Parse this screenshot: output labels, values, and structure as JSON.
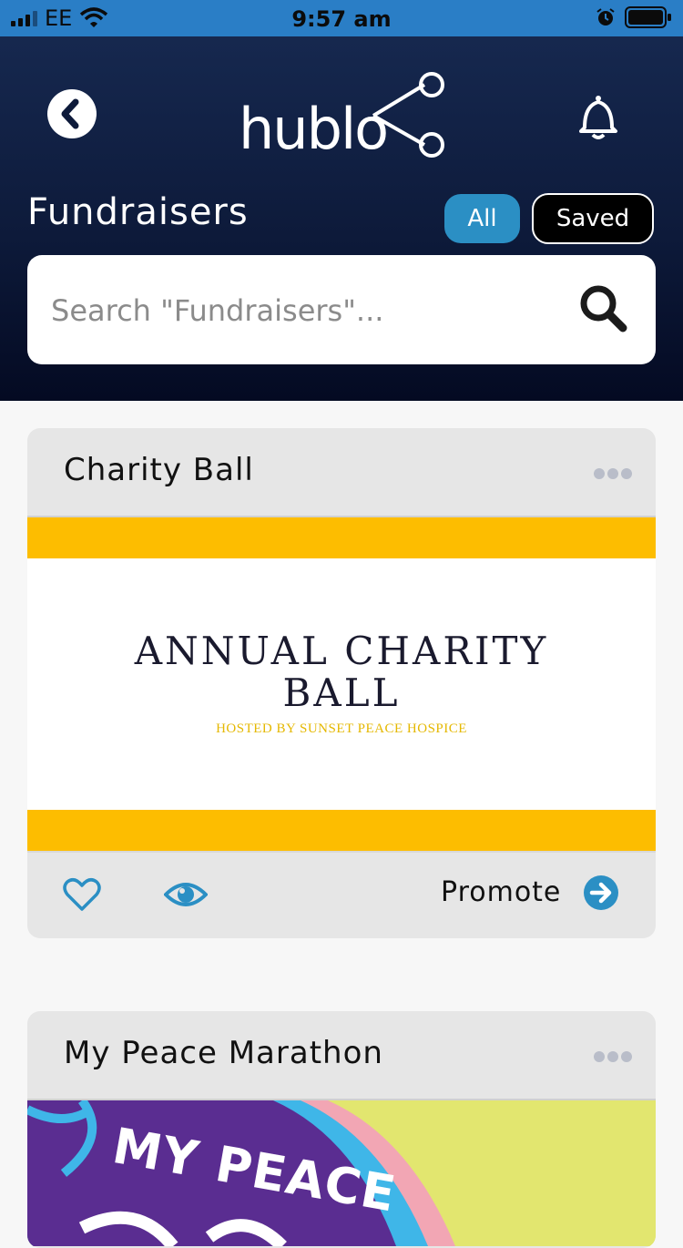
{
  "status_bar": {
    "carrier": "EE",
    "time": "9:57 am"
  },
  "header": {
    "logo_text": "hublo",
    "title": "Fundraisers",
    "tabs": [
      {
        "label": "All",
        "active": true
      },
      {
        "label": "Saved",
        "active": false
      }
    ],
    "search_placeholder": "Search \"Fundraisers\"..."
  },
  "cards": [
    {
      "title": "Charity Ball",
      "poster": {
        "title_line1": "ANNUAL CHARITY",
        "title_line2": "BALL",
        "subtitle": "HOSTED BY SUNSET PEACE HOSPICE"
      },
      "promote_label": "Promote"
    },
    {
      "title": "My Peace Marathon",
      "poster": {
        "title_text": "MY PEACE"
      }
    }
  ],
  "colors": {
    "header_top": "#16284f",
    "header_bottom": "#040a22",
    "accent": "#2b8fc4",
    "poster_band": "#fdbd00"
  }
}
